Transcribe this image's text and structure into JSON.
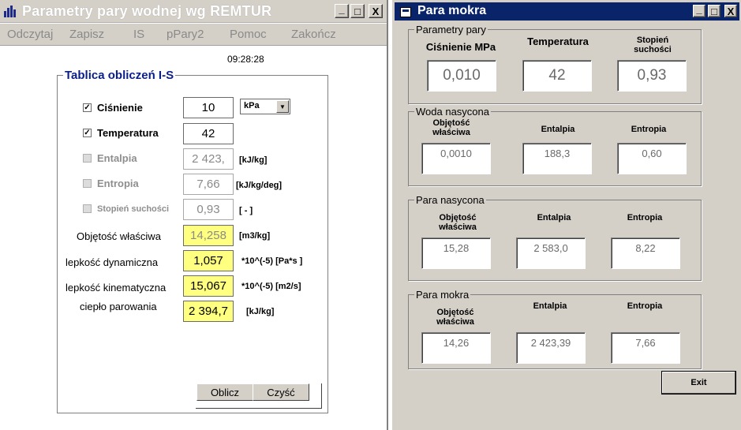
{
  "left_window": {
    "title": "Parametry pary wodnej  wg REMTUR",
    "menu": [
      "Odczytaj",
      "Zapisz",
      "IS",
      "pPary2",
      "Pomoc",
      "Zakończ"
    ],
    "clock": "09:28:28",
    "group_title": "Tablica obliczeń I-S",
    "rows": {
      "cisnienie": {
        "label": "Ciśnienie",
        "value": "10",
        "unit_select": "kPa",
        "checked": true
      },
      "temperatura": {
        "label": "Temperatura",
        "value": "42",
        "checked": true
      },
      "entalpia": {
        "label": "Entalpia",
        "value": "2 423,",
        "unit": "[kJ/kg]",
        "checked": false
      },
      "entropia": {
        "label": "Entropia",
        "value": "7,66",
        "unit": "[kJ/kg/deg]",
        "checked": false
      },
      "stopien": {
        "label": "Stopień suchości",
        "value": "0,93",
        "unit": "[ - ]",
        "checked": false
      }
    },
    "results": {
      "objetosc": {
        "label": "Objętość właściwa",
        "value": "14,258",
        "unit": "[m3/kg]"
      },
      "lep_dyn": {
        "label": "lepkość dynamiczna",
        "value": "1,057",
        "unit": "*10^(-5)  [Pa*s ]"
      },
      "lep_kin": {
        "label": "lepkość  kinematyczna",
        "value": "15,067",
        "unit": "*10^(-5) [m2/s]"
      },
      "cieplo": {
        "label": "ciepło parowania",
        "value": "2 394,7",
        "unit": "[kJ/kg]"
      }
    },
    "buttons": {
      "oblicz": "Oblicz",
      "czysc": "Czyść"
    },
    "window_controls": {
      "minimize": "_",
      "maximize": "□",
      "close": "X"
    }
  },
  "right_window": {
    "title": "Para mokra",
    "parametry": {
      "title": "Parametry pary",
      "labels": {
        "cisnienie": "Ciśnienie MPa",
        "temperatura": "Temperatura",
        "stopien": "Stopień\nsuchości"
      },
      "values": {
        "cisnienie": "0,010",
        "temperatura": "42",
        "stopien": "0,93"
      }
    },
    "woda": {
      "title": "Woda nasycona",
      "labels": {
        "objetosc": "Objętość\nwłaściwa",
        "entalpia": "Entalpia",
        "entropia": "Entropia"
      },
      "values": {
        "objetosc": "0,0010",
        "entalpia": "188,3",
        "entropia": "0,60"
      }
    },
    "para_nasycona": {
      "title": "Para nasycona",
      "labels": {
        "objetosc": "Objętość\nwłaściwa",
        "entalpia": "Entalpia",
        "entropia": "Entropia"
      },
      "values": {
        "objetosc": "15,28",
        "entalpia": "2 583,0",
        "entropia": "8,22"
      }
    },
    "para_mokra": {
      "title": "Para mokra",
      "labels": {
        "objetosc": "Objętość\nwłaściwa",
        "entalpia": "Entalpia",
        "entropia": "Entropia"
      },
      "values": {
        "objetosc": "14,26",
        "entalpia": "2 423,39",
        "entropia": "7,66"
      }
    },
    "exit_label": "Exit",
    "window_controls": {
      "minimize": "_",
      "maximize": "□",
      "close": "X"
    }
  },
  "colors": {
    "active_title": "#0a246a",
    "highlight": "#ffff80",
    "group_title": "#0a1f8a",
    "face": "#d4d0c8"
  }
}
